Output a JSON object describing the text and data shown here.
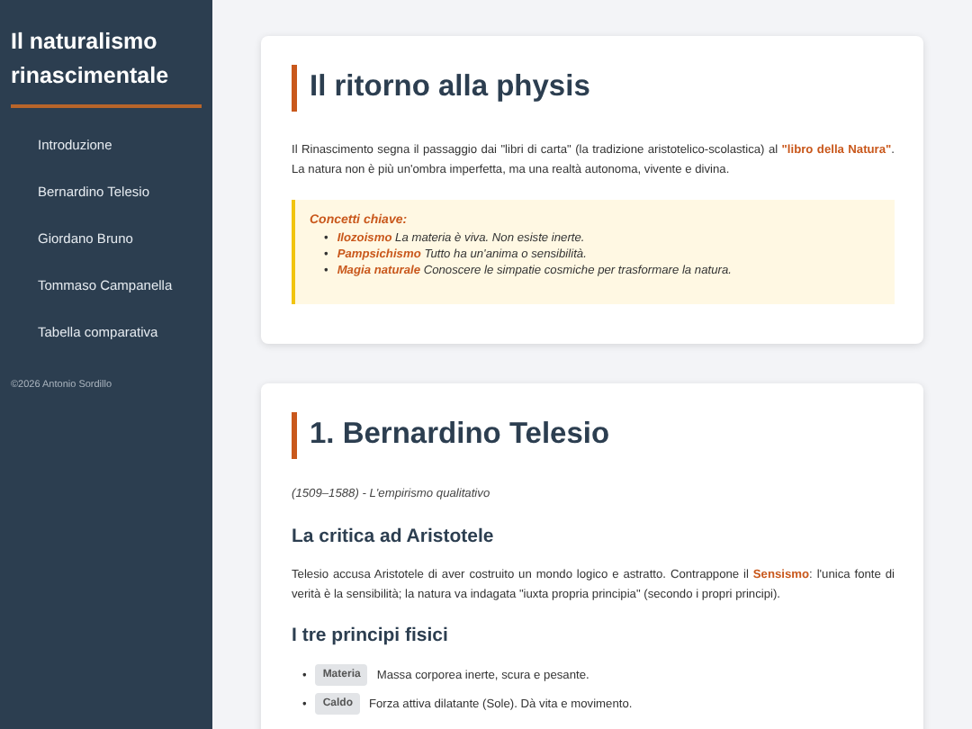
{
  "sidebar": {
    "title": "Il naturalismo rinascimentale",
    "items": [
      {
        "label": "Introduzione"
      },
      {
        "label": "Bernardino Telesio"
      },
      {
        "label": "Giordano Bruno"
      },
      {
        "label": "Tommaso Campanella"
      },
      {
        "label": "Tabella comparativa"
      }
    ],
    "footer": "©2026 Antonio Sordillo"
  },
  "sections": [
    {
      "heading": "Il ritorno alla physis",
      "blocks": [
        {
          "kind": "paragraph",
          "text": "Il Rinascimento segna il passaggio dai \"libri di carta\" (la tradizione aristotelico-scolastica) al **\"libro della Natura\"**. La natura non è più un'ombra imperfetta, ma una realtà autonoma, vivente e divina."
        },
        {
          "kind": "callout",
          "title": "Concetti chiave:",
          "items": [
            {
              "bullet": "•",
              "term": "Ilozoismo",
              "text": "La materia è viva. Non esiste inerte."
            },
            {
              "bullet": "•",
              "term": "Pampsichismo",
              "text": "Tutto ha un'anima o sensibilità."
            },
            {
              "bullet": "•",
              "term": "Magia naturale",
              "text": "Conoscere le simpatie cosmiche per trasformare la natura."
            }
          ]
        }
      ]
    },
    {
      "heading": "1. Bernardino Telesio",
      "blocks": [
        {
          "kind": "subtitle",
          "text": "(1509–1588) - L'empirismo qualitativo"
        },
        {
          "kind": "subheading",
          "text": "La critica ad Aristotele"
        },
        {
          "kind": "paragraph",
          "text": "Telesio accusa Aristotele di aver costruito un mondo logico e astratto. Contrappone il **Sensismo**: l'unica fonte di verità è la sensibilità; la natura va indagata \"iuxta propria principia\" (secondo i propri principi)."
        },
        {
          "kind": "subheading",
          "text": "I tre principi fisici"
        },
        {
          "kind": "tags",
          "items": [
            {
              "bullet": "•",
              "tag": "Materia",
              "text": "Massa corporea inerte, scura e pesante."
            },
            {
              "bullet": "•",
              "tag": "Caldo",
              "text": "Forza attiva dilatante (Sole). Dà vita e movimento."
            }
          ]
        }
      ]
    }
  ]
}
